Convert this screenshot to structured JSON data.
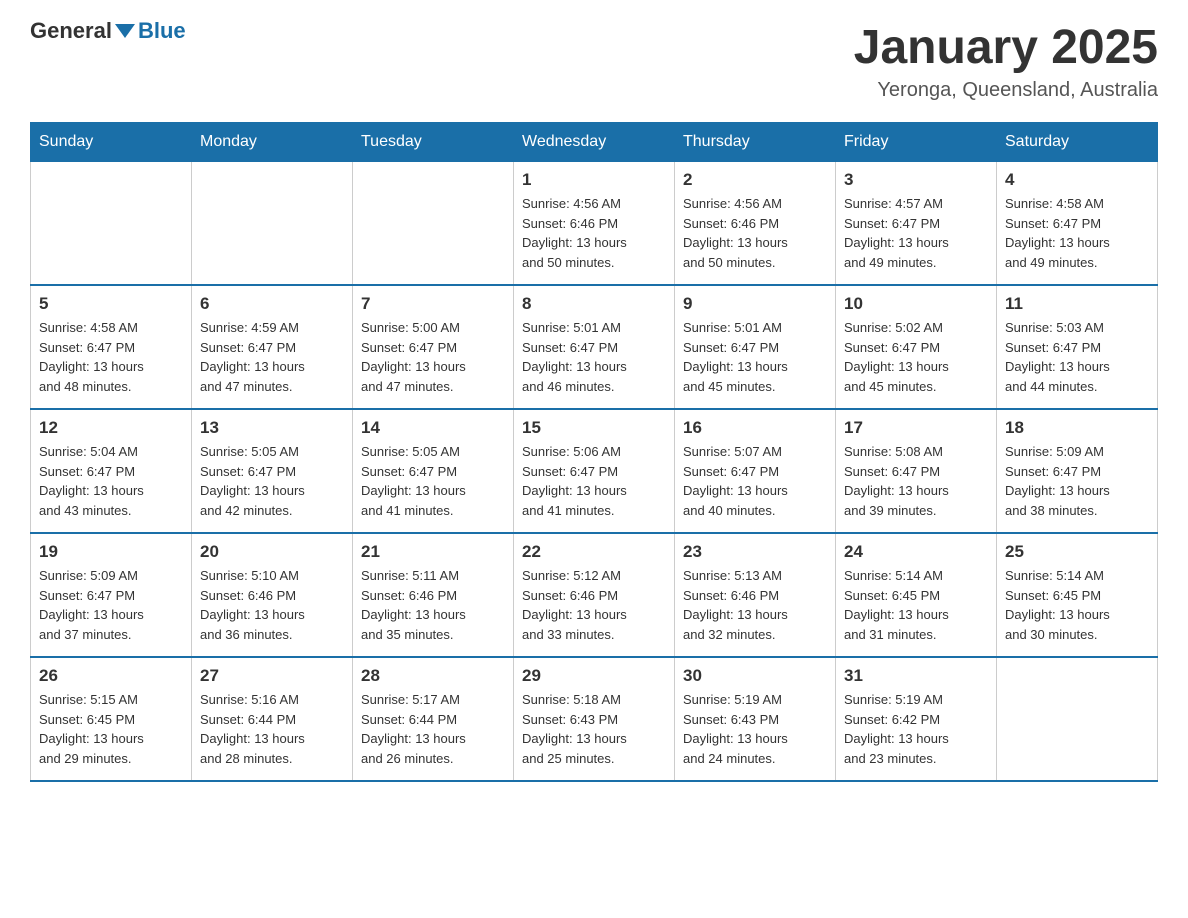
{
  "header": {
    "logo_general": "General",
    "logo_blue": "Blue",
    "title": "January 2025",
    "location": "Yeronga, Queensland, Australia"
  },
  "days_of_week": [
    "Sunday",
    "Monday",
    "Tuesday",
    "Wednesday",
    "Thursday",
    "Friday",
    "Saturday"
  ],
  "weeks": [
    [
      {
        "day": "",
        "info": ""
      },
      {
        "day": "",
        "info": ""
      },
      {
        "day": "",
        "info": ""
      },
      {
        "day": "1",
        "info": "Sunrise: 4:56 AM\nSunset: 6:46 PM\nDaylight: 13 hours\nand 50 minutes."
      },
      {
        "day": "2",
        "info": "Sunrise: 4:56 AM\nSunset: 6:46 PM\nDaylight: 13 hours\nand 50 minutes."
      },
      {
        "day": "3",
        "info": "Sunrise: 4:57 AM\nSunset: 6:47 PM\nDaylight: 13 hours\nand 49 minutes."
      },
      {
        "day": "4",
        "info": "Sunrise: 4:58 AM\nSunset: 6:47 PM\nDaylight: 13 hours\nand 49 minutes."
      }
    ],
    [
      {
        "day": "5",
        "info": "Sunrise: 4:58 AM\nSunset: 6:47 PM\nDaylight: 13 hours\nand 48 minutes."
      },
      {
        "day": "6",
        "info": "Sunrise: 4:59 AM\nSunset: 6:47 PM\nDaylight: 13 hours\nand 47 minutes."
      },
      {
        "day": "7",
        "info": "Sunrise: 5:00 AM\nSunset: 6:47 PM\nDaylight: 13 hours\nand 47 minutes."
      },
      {
        "day": "8",
        "info": "Sunrise: 5:01 AM\nSunset: 6:47 PM\nDaylight: 13 hours\nand 46 minutes."
      },
      {
        "day": "9",
        "info": "Sunrise: 5:01 AM\nSunset: 6:47 PM\nDaylight: 13 hours\nand 45 minutes."
      },
      {
        "day": "10",
        "info": "Sunrise: 5:02 AM\nSunset: 6:47 PM\nDaylight: 13 hours\nand 45 minutes."
      },
      {
        "day": "11",
        "info": "Sunrise: 5:03 AM\nSunset: 6:47 PM\nDaylight: 13 hours\nand 44 minutes."
      }
    ],
    [
      {
        "day": "12",
        "info": "Sunrise: 5:04 AM\nSunset: 6:47 PM\nDaylight: 13 hours\nand 43 minutes."
      },
      {
        "day": "13",
        "info": "Sunrise: 5:05 AM\nSunset: 6:47 PM\nDaylight: 13 hours\nand 42 minutes."
      },
      {
        "day": "14",
        "info": "Sunrise: 5:05 AM\nSunset: 6:47 PM\nDaylight: 13 hours\nand 41 minutes."
      },
      {
        "day": "15",
        "info": "Sunrise: 5:06 AM\nSunset: 6:47 PM\nDaylight: 13 hours\nand 41 minutes."
      },
      {
        "day": "16",
        "info": "Sunrise: 5:07 AM\nSunset: 6:47 PM\nDaylight: 13 hours\nand 40 minutes."
      },
      {
        "day": "17",
        "info": "Sunrise: 5:08 AM\nSunset: 6:47 PM\nDaylight: 13 hours\nand 39 minutes."
      },
      {
        "day": "18",
        "info": "Sunrise: 5:09 AM\nSunset: 6:47 PM\nDaylight: 13 hours\nand 38 minutes."
      }
    ],
    [
      {
        "day": "19",
        "info": "Sunrise: 5:09 AM\nSunset: 6:47 PM\nDaylight: 13 hours\nand 37 minutes."
      },
      {
        "day": "20",
        "info": "Sunrise: 5:10 AM\nSunset: 6:46 PM\nDaylight: 13 hours\nand 36 minutes."
      },
      {
        "day": "21",
        "info": "Sunrise: 5:11 AM\nSunset: 6:46 PM\nDaylight: 13 hours\nand 35 minutes."
      },
      {
        "day": "22",
        "info": "Sunrise: 5:12 AM\nSunset: 6:46 PM\nDaylight: 13 hours\nand 33 minutes."
      },
      {
        "day": "23",
        "info": "Sunrise: 5:13 AM\nSunset: 6:46 PM\nDaylight: 13 hours\nand 32 minutes."
      },
      {
        "day": "24",
        "info": "Sunrise: 5:14 AM\nSunset: 6:45 PM\nDaylight: 13 hours\nand 31 minutes."
      },
      {
        "day": "25",
        "info": "Sunrise: 5:14 AM\nSunset: 6:45 PM\nDaylight: 13 hours\nand 30 minutes."
      }
    ],
    [
      {
        "day": "26",
        "info": "Sunrise: 5:15 AM\nSunset: 6:45 PM\nDaylight: 13 hours\nand 29 minutes."
      },
      {
        "day": "27",
        "info": "Sunrise: 5:16 AM\nSunset: 6:44 PM\nDaylight: 13 hours\nand 28 minutes."
      },
      {
        "day": "28",
        "info": "Sunrise: 5:17 AM\nSunset: 6:44 PM\nDaylight: 13 hours\nand 26 minutes."
      },
      {
        "day": "29",
        "info": "Sunrise: 5:18 AM\nSunset: 6:43 PM\nDaylight: 13 hours\nand 25 minutes."
      },
      {
        "day": "30",
        "info": "Sunrise: 5:19 AM\nSunset: 6:43 PM\nDaylight: 13 hours\nand 24 minutes."
      },
      {
        "day": "31",
        "info": "Sunrise: 5:19 AM\nSunset: 6:42 PM\nDaylight: 13 hours\nand 23 minutes."
      },
      {
        "day": "",
        "info": ""
      }
    ]
  ]
}
